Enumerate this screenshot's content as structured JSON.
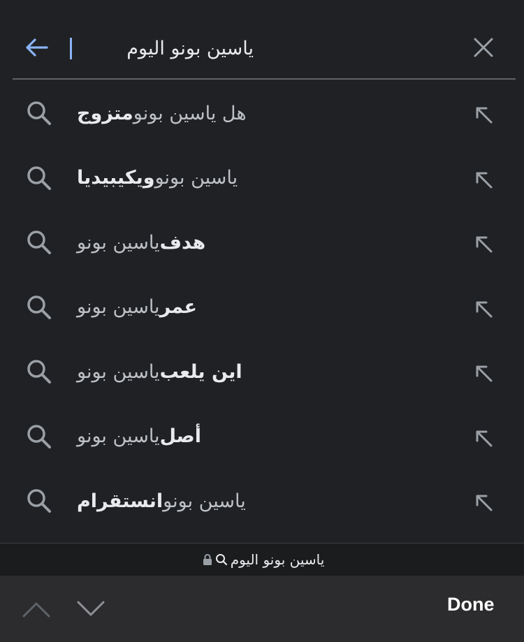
{
  "search": {
    "query": "ياسين بونو اليوم",
    "back_icon": "arrow-left-icon",
    "clear_icon": "close-icon",
    "accent_color": "#8ab4f8"
  },
  "suggestions": [
    {
      "prefix": "هل ياسين بونو ",
      "bold": "متزوج",
      "suffix": ""
    },
    {
      "prefix": "ياسين بونو ",
      "bold": "ويكيبيديا",
      "suffix": ""
    },
    {
      "prefix": "",
      "bold": "هدف",
      "suffix": " ياسين بونو"
    },
    {
      "prefix": "",
      "bold": "عمر",
      "suffix": " ياسين بونو"
    },
    {
      "prefix": "",
      "bold": "اين يلعب",
      "suffix": " ياسين بونو"
    },
    {
      "prefix": "",
      "bold": "أصل",
      "suffix": " ياسين بونو"
    },
    {
      "prefix": "ياسين بونو ",
      "bold": "انستقرام",
      "suffix": ""
    }
  ],
  "url_bar": {
    "text": "ياسين بونو اليوم",
    "lock_icon": "lock-icon",
    "search_icon": "search-icon"
  },
  "keyboard_toolbar": {
    "prev_icon": "chevron-up-icon",
    "next_icon": "chevron-down-icon",
    "done_label": "Done"
  }
}
